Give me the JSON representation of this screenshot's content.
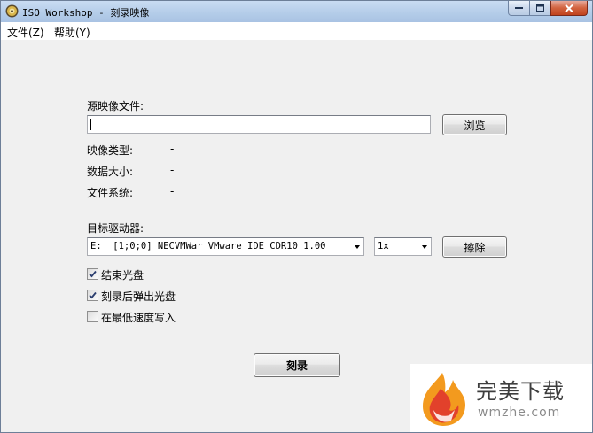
{
  "window": {
    "title": "ISO Workshop - 刻录映像",
    "caption_buttons": [
      "minimize",
      "maximize",
      "close"
    ]
  },
  "menu": {
    "items": [
      {
        "label": "文件(Z)"
      },
      {
        "label": "帮助(Y)"
      }
    ]
  },
  "source": {
    "label": "源映像文件:",
    "path_value": "",
    "browse_label": "浏览"
  },
  "info": [
    {
      "label": "映像类型:",
      "value": "-"
    },
    {
      "label": "数据大小:",
      "value": "-"
    },
    {
      "label": "文件系统:",
      "value": "-"
    }
  ],
  "target": {
    "label": "目标驱动器:",
    "drive_selected": "E:  [1;0;0] NECVMWar VMware IDE CDR10 1.00",
    "speed_selected": "1x",
    "erase_label": "擦除"
  },
  "options": [
    {
      "label": "结束光盘",
      "checked": true
    },
    {
      "label": "刻录后弹出光盘",
      "checked": true
    },
    {
      "label": "在最低速度写入",
      "checked": false
    }
  ],
  "burn_label": "刻录",
  "watermark": {
    "title": "完美下载",
    "subtitle": "wmzhe.com"
  },
  "colors": {
    "titlebar": "#b9cfea",
    "close_button": "#c8502c",
    "window_bg": "#f0f0f0",
    "watermark_flame_orange": "#f39a1e",
    "watermark_flame_red": "#e2412b"
  }
}
